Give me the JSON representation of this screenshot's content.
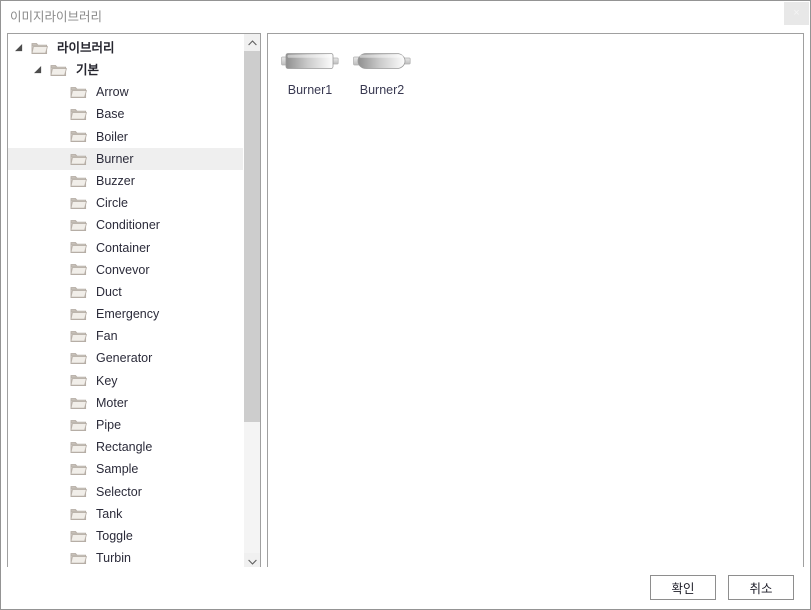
{
  "window": {
    "title": "이미지라이브러리",
    "close_label": "×"
  },
  "tree": {
    "nodes": [
      {
        "label": "라이브러리",
        "level": 0,
        "expanded": true,
        "selected": false,
        "korean": true
      },
      {
        "label": "기본",
        "level": 1,
        "expanded": true,
        "selected": false,
        "korean": true
      },
      {
        "label": "Arrow",
        "level": 2,
        "expanded": false,
        "selected": false,
        "korean": false
      },
      {
        "label": "Base",
        "level": 2,
        "expanded": false,
        "selected": false,
        "korean": false
      },
      {
        "label": "Boiler",
        "level": 2,
        "expanded": false,
        "selected": false,
        "korean": false
      },
      {
        "label": "Burner",
        "level": 2,
        "expanded": false,
        "selected": true,
        "korean": false
      },
      {
        "label": "Buzzer",
        "level": 2,
        "expanded": false,
        "selected": false,
        "korean": false
      },
      {
        "label": "Circle",
        "level": 2,
        "expanded": false,
        "selected": false,
        "korean": false
      },
      {
        "label": "Conditioner",
        "level": 2,
        "expanded": false,
        "selected": false,
        "korean": false
      },
      {
        "label": "Container",
        "level": 2,
        "expanded": false,
        "selected": false,
        "korean": false
      },
      {
        "label": "Convevor",
        "level": 2,
        "expanded": false,
        "selected": false,
        "korean": false
      },
      {
        "label": "Duct",
        "level": 2,
        "expanded": false,
        "selected": false,
        "korean": false
      },
      {
        "label": "Emergency",
        "level": 2,
        "expanded": false,
        "selected": false,
        "korean": false
      },
      {
        "label": "Fan",
        "level": 2,
        "expanded": false,
        "selected": false,
        "korean": false
      },
      {
        "label": "Generator",
        "level": 2,
        "expanded": false,
        "selected": false,
        "korean": false
      },
      {
        "label": "Key",
        "level": 2,
        "expanded": false,
        "selected": false,
        "korean": false
      },
      {
        "label": "Moter",
        "level": 2,
        "expanded": false,
        "selected": false,
        "korean": false
      },
      {
        "label": "Pipe",
        "level": 2,
        "expanded": false,
        "selected": false,
        "korean": false
      },
      {
        "label": "Rectangle",
        "level": 2,
        "expanded": false,
        "selected": false,
        "korean": false
      },
      {
        "label": "Sample",
        "level": 2,
        "expanded": false,
        "selected": false,
        "korean": false
      },
      {
        "label": "Selector",
        "level": 2,
        "expanded": false,
        "selected": false,
        "korean": false
      },
      {
        "label": "Tank",
        "level": 2,
        "expanded": false,
        "selected": false,
        "korean": false
      },
      {
        "label": "Toggle",
        "level": 2,
        "expanded": false,
        "selected": false,
        "korean": false
      },
      {
        "label": "Turbin",
        "level": 2,
        "expanded": false,
        "selected": false,
        "korean": false
      }
    ],
    "scrollbar": {
      "thumb_percent": 74,
      "up_arrow": "chevron-up",
      "down_arrow": "chevron-down"
    }
  },
  "items": {
    "thumbnails": [
      {
        "label": "Burner1",
        "shape": "burner-flat"
      },
      {
        "label": "Burner2",
        "shape": "burner-round"
      }
    ]
  },
  "footer": {
    "ok_label": "확인",
    "cancel_label": "취소"
  },
  "colors": {
    "frame_border": "#949494",
    "panel_border": "#a0a0a0",
    "selection": "#efefef",
    "scroll_thumb": "#cdcdcd",
    "title_text": "#8a8a8a",
    "label_text": "#3a3a52"
  }
}
